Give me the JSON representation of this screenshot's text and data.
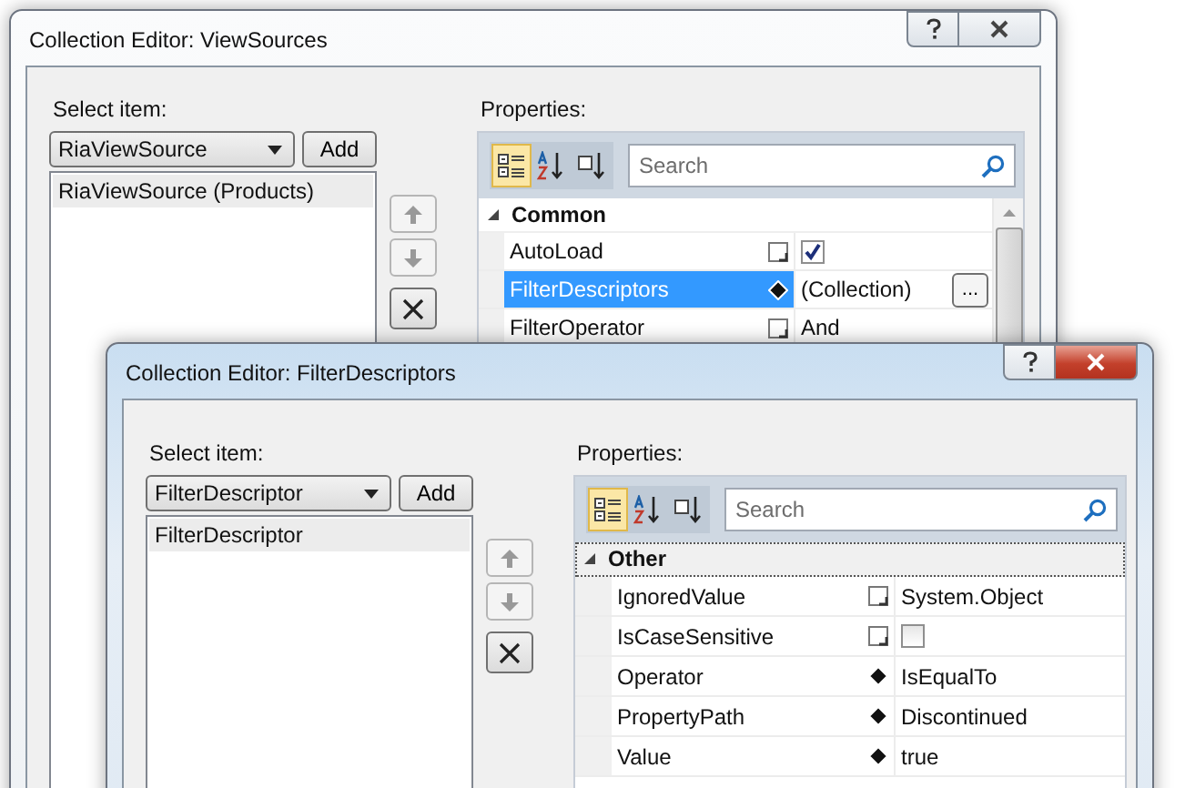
{
  "dialogs": [
    {
      "title": "Collection Editor: ViewSources",
      "active": false,
      "select_label": "Select item:",
      "type_value": "RiaViewSource",
      "add_label": "Add",
      "items": [
        {
          "label": "RiaViewSource (Products)",
          "selected": true
        }
      ],
      "properties_label": "Properties:",
      "search_placeholder": "Search",
      "category": {
        "name": "Common",
        "expanded": true,
        "focused": false
      },
      "properties": [
        {
          "name": "AutoLoad",
          "kind": "checkbox",
          "checked": true,
          "is_set": false,
          "selected": false
        },
        {
          "name": "FilterDescriptors",
          "kind": "collection",
          "value": "(Collection)",
          "button": "...",
          "is_set": true,
          "selected": true
        },
        {
          "name": "FilterOperator",
          "kind": "text",
          "value": "And",
          "is_set": false,
          "selected": false
        }
      ]
    },
    {
      "title": "Collection Editor: FilterDescriptors",
      "active": true,
      "select_label": "Select item:",
      "type_value": "FilterDescriptor",
      "add_label": "Add",
      "items": [
        {
          "label": "FilterDescriptor",
          "selected": true
        }
      ],
      "properties_label": "Properties:",
      "search_placeholder": "Search",
      "category": {
        "name": "Other",
        "expanded": true,
        "focused": true
      },
      "properties": [
        {
          "name": "IgnoredValue",
          "kind": "text",
          "value": "System.Object",
          "is_set": false,
          "selected": false
        },
        {
          "name": "IsCaseSensitive",
          "kind": "checkbox",
          "checked": false,
          "is_set": false,
          "selected": false
        },
        {
          "name": "Operator",
          "kind": "text",
          "value": "IsEqualTo",
          "is_set": true,
          "selected": false
        },
        {
          "name": "PropertyPath",
          "kind": "text",
          "value": "Discontinued",
          "is_set": true,
          "selected": false
        },
        {
          "name": "Value",
          "kind": "text",
          "value": "true",
          "is_set": true,
          "selected": false
        }
      ]
    }
  ]
}
